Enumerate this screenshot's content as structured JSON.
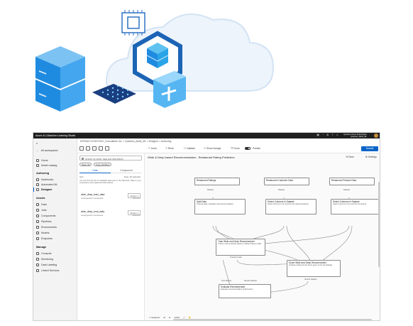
{
  "app": {
    "brand": "Azure AI | Machine Learning Studio",
    "account_line1": "Questers Azure Subscription",
    "account_line2": "Question_Bank_ML"
  },
  "breadcrumb": "DEFAULT/CONTOSO_Consultants Inc. > Question_Bank_ML > Designer > Authoring",
  "leftnav": {
    "all_workspaces": "All workspaces",
    "home": "Home",
    "model_catalog": "Model catalog",
    "authoring_header": "Authoring",
    "notebooks": "Notebooks",
    "automated_ml": "Automated ML",
    "designer": "Designer",
    "assets_header": "Assets",
    "data": "Data",
    "jobs": "Jobs",
    "components": "Components",
    "pipelines": "Pipelines",
    "environments": "Environments",
    "models": "Models",
    "endpoints": "Endpoints",
    "manage_header": "Manage",
    "compute": "Compute",
    "monitoring": "Monitoring",
    "data_labeling": "Data Labeling",
    "linked_services": "Linked Services"
  },
  "toolbar": {
    "undo": "Undo",
    "redo": "Redo",
    "validate": "Validate",
    "show_lineage": "Show lineage",
    "clone": "Clone",
    "publish": "Publish",
    "submit": "Submit"
  },
  "palette": {
    "search_placeholder": "Search by name, tags and description",
    "chip_tags": "Tags: All",
    "chip_filter": "Type: All filters",
    "tab_data": "Data",
    "tab_component": "Component",
    "filter_left": "Sort",
    "filter_right": "Type: All selected",
    "description": "You can find the list of available data sets in the Data tab. Data in your workspace and registered data assets.",
    "items": [
      {
        "name": "wide_deep_train_data",
        "sub": "Local generic component",
        "version": "Version 1",
        "date": "10/8/2023"
      },
      {
        "name": "wide_deep_eval_data",
        "sub": "Local generic component",
        "version": "Version 1",
        "date": "10/8/2023"
      }
    ]
  },
  "canvas": {
    "title": "Wide & Deep based Recommendation - Restaurant Rating Prediction",
    "save": "Save",
    "settings": "Settings",
    "zoom": "100%",
    "navigator": "Navigator",
    "nodes": {
      "ratings": "Restaurant Ratings",
      "customer": "Restaurant Customer Data",
      "feature": "Restaurant Feature Data",
      "join1_title": "Split Data",
      "join1_sub": "Training data, evaluation and scoring dataset",
      "join2_title": "Select Columns in Dataset",
      "join2_sub": "Select columns to be used for the training features",
      "join3_title": "Select Columns in Dataset",
      "join3_sub": "Select columns to be used for the feature",
      "train_title": "Train Wide and Deep Recommender",
      "train_sub": "Trains a recommender based on Wide & Deep model",
      "score_title": "Score Wide and Deep Recommender",
      "score_sub": "Produce ratings for the items given in the test dataset",
      "eval_title": "Evaluate Recommender",
      "eval_sub": "Evaluate recommendation performance"
    },
    "ports": {
      "dataset": "Dataset",
      "results": "Results dataset",
      "trained_model": "Trained model",
      "scored": "Scored dataset",
      "test": "Test dataset"
    }
  },
  "colors": {
    "accent": "#0a64c8",
    "topbar": "#1f1f1f"
  }
}
